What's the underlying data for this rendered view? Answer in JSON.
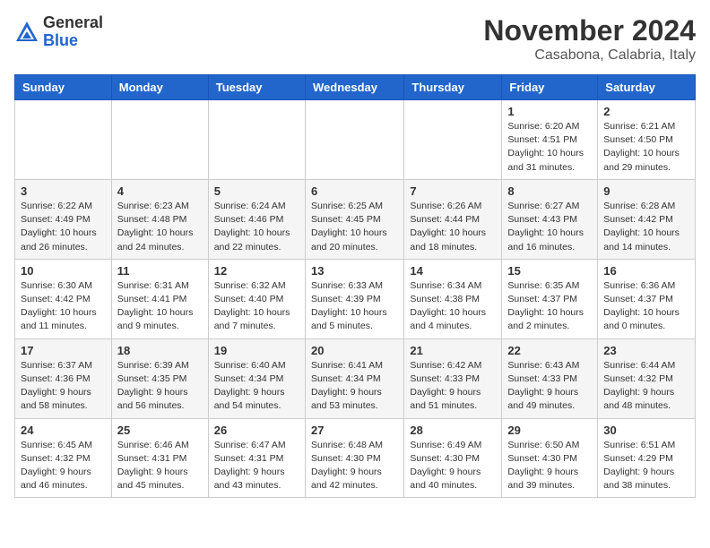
{
  "header": {
    "logo_general": "General",
    "logo_blue": "Blue",
    "month": "November 2024",
    "location": "Casabona, Calabria, Italy"
  },
  "days_of_week": [
    "Sunday",
    "Monday",
    "Tuesday",
    "Wednesday",
    "Thursday",
    "Friday",
    "Saturday"
  ],
  "weeks": [
    [
      {
        "day": "",
        "sunrise": "",
        "sunset": "",
        "daylight": ""
      },
      {
        "day": "",
        "sunrise": "",
        "sunset": "",
        "daylight": ""
      },
      {
        "day": "",
        "sunrise": "",
        "sunset": "",
        "daylight": ""
      },
      {
        "day": "",
        "sunrise": "",
        "sunset": "",
        "daylight": ""
      },
      {
        "day": "",
        "sunrise": "",
        "sunset": "",
        "daylight": ""
      },
      {
        "day": "1",
        "sunrise": "Sunrise: 6:20 AM",
        "sunset": "Sunset: 4:51 PM",
        "daylight": "Daylight: 10 hours and 31 minutes."
      },
      {
        "day": "2",
        "sunrise": "Sunrise: 6:21 AM",
        "sunset": "Sunset: 4:50 PM",
        "daylight": "Daylight: 10 hours and 29 minutes."
      }
    ],
    [
      {
        "day": "3",
        "sunrise": "Sunrise: 6:22 AM",
        "sunset": "Sunset: 4:49 PM",
        "daylight": "Daylight: 10 hours and 26 minutes."
      },
      {
        "day": "4",
        "sunrise": "Sunrise: 6:23 AM",
        "sunset": "Sunset: 4:48 PM",
        "daylight": "Daylight: 10 hours and 24 minutes."
      },
      {
        "day": "5",
        "sunrise": "Sunrise: 6:24 AM",
        "sunset": "Sunset: 4:46 PM",
        "daylight": "Daylight: 10 hours and 22 minutes."
      },
      {
        "day": "6",
        "sunrise": "Sunrise: 6:25 AM",
        "sunset": "Sunset: 4:45 PM",
        "daylight": "Daylight: 10 hours and 20 minutes."
      },
      {
        "day": "7",
        "sunrise": "Sunrise: 6:26 AM",
        "sunset": "Sunset: 4:44 PM",
        "daylight": "Daylight: 10 hours and 18 minutes."
      },
      {
        "day": "8",
        "sunrise": "Sunrise: 6:27 AM",
        "sunset": "Sunset: 4:43 PM",
        "daylight": "Daylight: 10 hours and 16 minutes."
      },
      {
        "day": "9",
        "sunrise": "Sunrise: 6:28 AM",
        "sunset": "Sunset: 4:42 PM",
        "daylight": "Daylight: 10 hours and 14 minutes."
      }
    ],
    [
      {
        "day": "10",
        "sunrise": "Sunrise: 6:30 AM",
        "sunset": "Sunset: 4:42 PM",
        "daylight": "Daylight: 10 hours and 11 minutes."
      },
      {
        "day": "11",
        "sunrise": "Sunrise: 6:31 AM",
        "sunset": "Sunset: 4:41 PM",
        "daylight": "Daylight: 10 hours and 9 minutes."
      },
      {
        "day": "12",
        "sunrise": "Sunrise: 6:32 AM",
        "sunset": "Sunset: 4:40 PM",
        "daylight": "Daylight: 10 hours and 7 minutes."
      },
      {
        "day": "13",
        "sunrise": "Sunrise: 6:33 AM",
        "sunset": "Sunset: 4:39 PM",
        "daylight": "Daylight: 10 hours and 5 minutes."
      },
      {
        "day": "14",
        "sunrise": "Sunrise: 6:34 AM",
        "sunset": "Sunset: 4:38 PM",
        "daylight": "Daylight: 10 hours and 4 minutes."
      },
      {
        "day": "15",
        "sunrise": "Sunrise: 6:35 AM",
        "sunset": "Sunset: 4:37 PM",
        "daylight": "Daylight: 10 hours and 2 minutes."
      },
      {
        "day": "16",
        "sunrise": "Sunrise: 6:36 AM",
        "sunset": "Sunset: 4:37 PM",
        "daylight": "Daylight: 10 hours and 0 minutes."
      }
    ],
    [
      {
        "day": "17",
        "sunrise": "Sunrise: 6:37 AM",
        "sunset": "Sunset: 4:36 PM",
        "daylight": "Daylight: 9 hours and 58 minutes."
      },
      {
        "day": "18",
        "sunrise": "Sunrise: 6:39 AM",
        "sunset": "Sunset: 4:35 PM",
        "daylight": "Daylight: 9 hours and 56 minutes."
      },
      {
        "day": "19",
        "sunrise": "Sunrise: 6:40 AM",
        "sunset": "Sunset: 4:34 PM",
        "daylight": "Daylight: 9 hours and 54 minutes."
      },
      {
        "day": "20",
        "sunrise": "Sunrise: 6:41 AM",
        "sunset": "Sunset: 4:34 PM",
        "daylight": "Daylight: 9 hours and 53 minutes."
      },
      {
        "day": "21",
        "sunrise": "Sunrise: 6:42 AM",
        "sunset": "Sunset: 4:33 PM",
        "daylight": "Daylight: 9 hours and 51 minutes."
      },
      {
        "day": "22",
        "sunrise": "Sunrise: 6:43 AM",
        "sunset": "Sunset: 4:33 PM",
        "daylight": "Daylight: 9 hours and 49 minutes."
      },
      {
        "day": "23",
        "sunrise": "Sunrise: 6:44 AM",
        "sunset": "Sunset: 4:32 PM",
        "daylight": "Daylight: 9 hours and 48 minutes."
      }
    ],
    [
      {
        "day": "24",
        "sunrise": "Sunrise: 6:45 AM",
        "sunset": "Sunset: 4:32 PM",
        "daylight": "Daylight: 9 hours and 46 minutes."
      },
      {
        "day": "25",
        "sunrise": "Sunrise: 6:46 AM",
        "sunset": "Sunset: 4:31 PM",
        "daylight": "Daylight: 9 hours and 45 minutes."
      },
      {
        "day": "26",
        "sunrise": "Sunrise: 6:47 AM",
        "sunset": "Sunset: 4:31 PM",
        "daylight": "Daylight: 9 hours and 43 minutes."
      },
      {
        "day": "27",
        "sunrise": "Sunrise: 6:48 AM",
        "sunset": "Sunset: 4:30 PM",
        "daylight": "Daylight: 9 hours and 42 minutes."
      },
      {
        "day": "28",
        "sunrise": "Sunrise: 6:49 AM",
        "sunset": "Sunset: 4:30 PM",
        "daylight": "Daylight: 9 hours and 40 minutes."
      },
      {
        "day": "29",
        "sunrise": "Sunrise: 6:50 AM",
        "sunset": "Sunset: 4:30 PM",
        "daylight": "Daylight: 9 hours and 39 minutes."
      },
      {
        "day": "30",
        "sunrise": "Sunrise: 6:51 AM",
        "sunset": "Sunset: 4:29 PM",
        "daylight": "Daylight: 9 hours and 38 minutes."
      }
    ]
  ]
}
